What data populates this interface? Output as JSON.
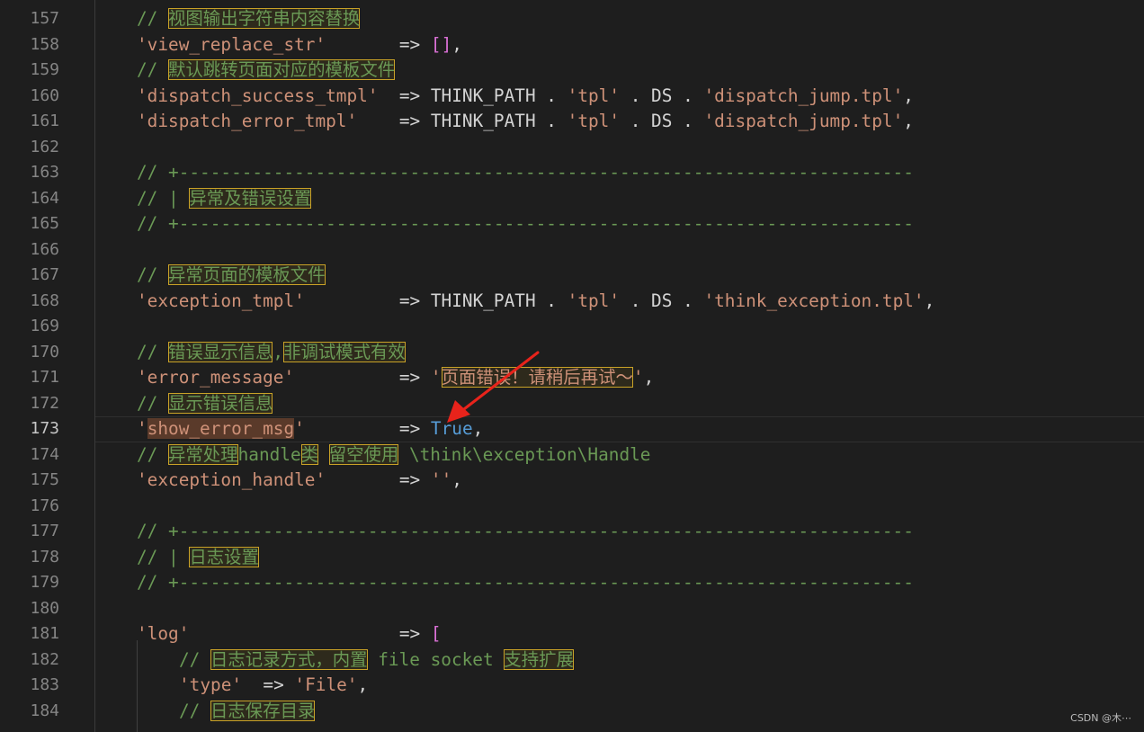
{
  "editor": {
    "lines": [
      {
        "n": "157",
        "indent": 1,
        "tokens": [
          {
            "t": "// ",
            "c": "cmt"
          },
          {
            "t": "视图输出字符串内容替换",
            "c": "cmt",
            "hl": true
          }
        ]
      },
      {
        "n": "158",
        "indent": 1,
        "tokens": [
          {
            "t": "'view_replace_str'",
            "c": "str"
          },
          {
            "t": "       => ",
            "c": "op"
          },
          {
            "t": "[]",
            "c": "br"
          },
          {
            "t": ",",
            "c": "op"
          }
        ]
      },
      {
        "n": "159",
        "indent": 1,
        "tokens": [
          {
            "t": "// ",
            "c": "cmt"
          },
          {
            "t": "默认跳转页面对应的模板文件",
            "c": "cmt",
            "hl": true
          }
        ]
      },
      {
        "n": "160",
        "indent": 1,
        "tokens": [
          {
            "t": "'dispatch_success_tmpl'",
            "c": "str"
          },
          {
            "t": "  => THINK_PATH . ",
            "c": "op"
          },
          {
            "t": "'tpl'",
            "c": "str"
          },
          {
            "t": " . DS . ",
            "c": "op"
          },
          {
            "t": "'dispatch_jump.tpl'",
            "c": "str"
          },
          {
            "t": ",",
            "c": "op"
          }
        ]
      },
      {
        "n": "161",
        "indent": 1,
        "tokens": [
          {
            "t": "'dispatch_error_tmpl'",
            "c": "str"
          },
          {
            "t": "    => THINK_PATH . ",
            "c": "op"
          },
          {
            "t": "'tpl'",
            "c": "str"
          },
          {
            "t": " . DS . ",
            "c": "op"
          },
          {
            "t": "'dispatch_jump.tpl'",
            "c": "str"
          },
          {
            "t": ",",
            "c": "op"
          }
        ]
      },
      {
        "n": "162",
        "indent": 0,
        "tokens": []
      },
      {
        "n": "163",
        "indent": 1,
        "tokens": [
          {
            "t": "// +----------------------------------------------------------------------",
            "c": "cmt"
          }
        ]
      },
      {
        "n": "164",
        "indent": 1,
        "tokens": [
          {
            "t": "// | ",
            "c": "cmt"
          },
          {
            "t": "异常及错误设置",
            "c": "cmt",
            "hl": true
          }
        ]
      },
      {
        "n": "165",
        "indent": 1,
        "tokens": [
          {
            "t": "// +----------------------------------------------------------------------",
            "c": "cmt"
          }
        ]
      },
      {
        "n": "166",
        "indent": 0,
        "tokens": []
      },
      {
        "n": "167",
        "indent": 1,
        "tokens": [
          {
            "t": "// ",
            "c": "cmt"
          },
          {
            "t": "异常页面的模板文件",
            "c": "cmt",
            "hl": true
          }
        ]
      },
      {
        "n": "168",
        "indent": 1,
        "tokens": [
          {
            "t": "'exception_tmpl'",
            "c": "str"
          },
          {
            "t": "         => THINK_PATH . ",
            "c": "op"
          },
          {
            "t": "'tpl'",
            "c": "str"
          },
          {
            "t": " . DS . ",
            "c": "op"
          },
          {
            "t": "'think_exception.tpl'",
            "c": "str"
          },
          {
            "t": ",",
            "c": "op"
          }
        ]
      },
      {
        "n": "169",
        "indent": 0,
        "tokens": []
      },
      {
        "n": "170",
        "indent": 1,
        "tokens": [
          {
            "t": "// ",
            "c": "cmt"
          },
          {
            "t": "错误显示信息",
            "c": "cmt",
            "hl": true
          },
          {
            "t": ",",
            "c": "cmt"
          },
          {
            "t": "非调试模式有效",
            "c": "cmt",
            "hl": true
          }
        ]
      },
      {
        "n": "171",
        "indent": 1,
        "tokens": [
          {
            "t": "'error_message'",
            "c": "str"
          },
          {
            "t": "          => ",
            "c": "op"
          },
          {
            "t": "'",
            "c": "str"
          },
          {
            "t": "页面错误！请稍后再试～",
            "c": "str",
            "hl": true
          },
          {
            "t": "'",
            "c": "str"
          },
          {
            "t": ",",
            "c": "op"
          }
        ]
      },
      {
        "n": "172",
        "indent": 1,
        "tokens": [
          {
            "t": "// ",
            "c": "cmt"
          },
          {
            "t": "显示错误信息",
            "c": "cmt",
            "hl": true
          }
        ]
      },
      {
        "n": "173",
        "indent": 1,
        "active": true,
        "tokens": [
          {
            "t": "'",
            "c": "str"
          },
          {
            "t": "show_error_msg",
            "c": "str",
            "sel": true
          },
          {
            "t": "'",
            "c": "str"
          },
          {
            "t": "         => ",
            "c": "op"
          },
          {
            "t": "True",
            "c": "kw"
          },
          {
            "t": ",",
            "c": "op"
          }
        ]
      },
      {
        "n": "174",
        "indent": 1,
        "tokens": [
          {
            "t": "// ",
            "c": "cmt"
          },
          {
            "t": "异常处理",
            "c": "cmt",
            "hl": true
          },
          {
            "t": "handle",
            "c": "cmt"
          },
          {
            "t": "类",
            "c": "cmt",
            "hl": true
          },
          {
            "t": " ",
            "c": "cmt"
          },
          {
            "t": "留空使用",
            "c": "cmt",
            "hl": true
          },
          {
            "t": " \\think\\exception\\Handle",
            "c": "cmt"
          }
        ]
      },
      {
        "n": "175",
        "indent": 1,
        "tokens": [
          {
            "t": "'exception_handle'",
            "c": "str"
          },
          {
            "t": "       => ",
            "c": "op"
          },
          {
            "t": "''",
            "c": "str"
          },
          {
            "t": ",",
            "c": "op"
          }
        ]
      },
      {
        "n": "176",
        "indent": 0,
        "tokens": []
      },
      {
        "n": "177",
        "indent": 1,
        "tokens": [
          {
            "t": "// +----------------------------------------------------------------------",
            "c": "cmt"
          }
        ]
      },
      {
        "n": "178",
        "indent": 1,
        "tokens": [
          {
            "t": "// | ",
            "c": "cmt"
          },
          {
            "t": "日志设置",
            "c": "cmt",
            "hl": true
          }
        ]
      },
      {
        "n": "179",
        "indent": 1,
        "tokens": [
          {
            "t": "// +----------------------------------------------------------------------",
            "c": "cmt"
          }
        ]
      },
      {
        "n": "180",
        "indent": 0,
        "tokens": []
      },
      {
        "n": "181",
        "indent": 1,
        "tokens": [
          {
            "t": "'log'",
            "c": "str"
          },
          {
            "t": "                    => ",
            "c": "op"
          },
          {
            "t": "[",
            "c": "br"
          }
        ]
      },
      {
        "n": "182",
        "indent": 2,
        "tokens": [
          {
            "t": "// ",
            "c": "cmt"
          },
          {
            "t": "日志记录方式，内置",
            "c": "cmt",
            "hl": true
          },
          {
            "t": " file socket ",
            "c": "cmt"
          },
          {
            "t": "支持扩展",
            "c": "cmt",
            "hl": true
          }
        ]
      },
      {
        "n": "183",
        "indent": 2,
        "tokens": [
          {
            "t": "'type'",
            "c": "str"
          },
          {
            "t": "  => ",
            "c": "op"
          },
          {
            "t": "'File'",
            "c": "str"
          },
          {
            "t": ",",
            "c": "op"
          }
        ]
      },
      {
        "n": "184",
        "indent": 2,
        "tokens": [
          {
            "t": "// ",
            "c": "cmt"
          },
          {
            "t": "日志保存目录",
            "c": "cmt",
            "hl": true
          }
        ]
      }
    ]
  },
  "colors": {
    "comment": "#6a9955",
    "string": "#ce9178",
    "keyword": "#569cd6",
    "bracket": "#da70d6",
    "text": "#d4d4d4",
    "annotation_arrow": "#e8231b"
  },
  "watermark": "CSDN @木⋯"
}
